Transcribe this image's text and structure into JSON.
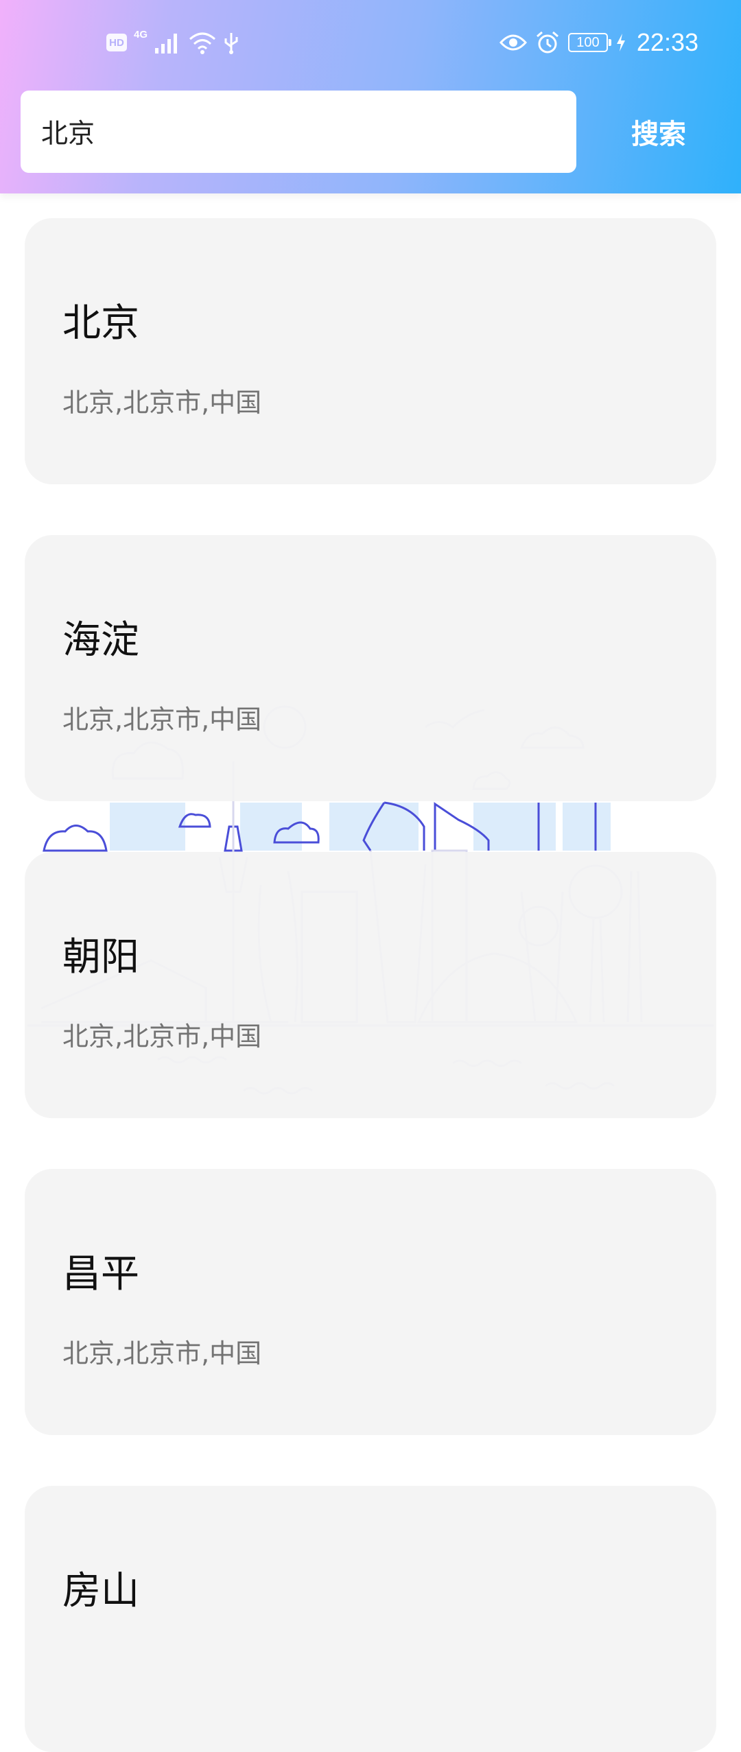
{
  "status_bar": {
    "hd_label": "HD",
    "network_label": "4G",
    "battery_level": "100",
    "time": "22:33",
    "icons": [
      "hd-icon",
      "signal-icon",
      "wifi-icon",
      "usb-icon",
      "eye-icon",
      "alarm-icon",
      "battery-icon",
      "charging-icon"
    ]
  },
  "search": {
    "value": "北京",
    "placeholder": "",
    "button_label": "搜索"
  },
  "results": [
    {
      "name": "北京",
      "region": "北京,北京市,中国"
    },
    {
      "name": "海淀",
      "region": "北京,北京市,中国"
    },
    {
      "name": "朝阳",
      "region": "北京,北京市,中国"
    },
    {
      "name": "昌平",
      "region": "北京,北京市,中国"
    },
    {
      "name": "房山",
      "region": ""
    }
  ],
  "colors": {
    "gradient_start": "#f1b1fb",
    "gradient_end": "#2fb1fb",
    "card_bg": "#f3f3f3",
    "skyline_accent": "#4a4ed8",
    "skyline_light": "#dcecfb"
  }
}
